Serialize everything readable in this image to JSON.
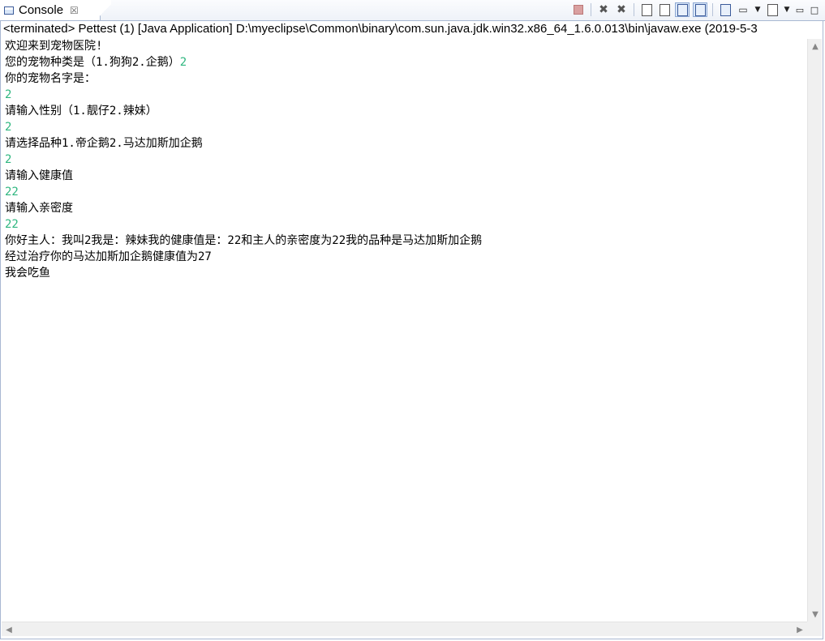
{
  "tab": {
    "label": "Console",
    "close_glyph": "☒"
  },
  "toolbar": {
    "icons": [
      "terminate-icon",
      "remove-launch-icon",
      "remove-all-icon",
      "clear-console-icon",
      "scroll-lock-icon",
      "word-wrap-icon",
      "show-on-stdout-icon",
      "pin-console-icon",
      "display-console-icon",
      "open-console-icon",
      "minimize-icon",
      "maximize-icon"
    ]
  },
  "header": {
    "text": "<terminated> Pettest (1) [Java Application] D:\\myeclipse\\Common\\binary\\com.sun.java.jdk.win32.x86_64_1.6.0.013\\bin\\javaw.exe (2019-5-3"
  },
  "console": {
    "output_color": "#000000",
    "input_color": "#2eb67f",
    "lines": [
      {
        "text": "欢迎来到宠物医院!",
        "input": ""
      },
      {
        "text": "您的宠物种类是（1.狗狗2.企鹅）",
        "input": "2"
      },
      {
        "text": "你的宠物名字是：",
        "input": ""
      },
      {
        "text": "",
        "input": "2"
      },
      {
        "text": "请输入性别（1.靓仔2.辣妹）",
        "input": ""
      },
      {
        "text": "",
        "input": "2"
      },
      {
        "text": "请选择品种1.帝企鹅2.马达加斯加企鹅",
        "input": ""
      },
      {
        "text": "",
        "input": "2"
      },
      {
        "text": "请输入健康值",
        "input": ""
      },
      {
        "text": "",
        "input": "22"
      },
      {
        "text": "请输入亲密度",
        "input": ""
      },
      {
        "text": "",
        "input": "22"
      },
      {
        "text": "你好主人：我叫2我是：辣妹我的健康值是：22和主人的亲密度为22我的品种是马达加斯加企鹅",
        "input": ""
      },
      {
        "text": "经过治疗你的马达加斯加企鹅健康值为27",
        "input": ""
      },
      {
        "text": "我会吃鱼",
        "input": ""
      }
    ]
  },
  "scrollbar": {
    "up": "▲",
    "down": "▼",
    "left": "◀",
    "right": "▶"
  }
}
